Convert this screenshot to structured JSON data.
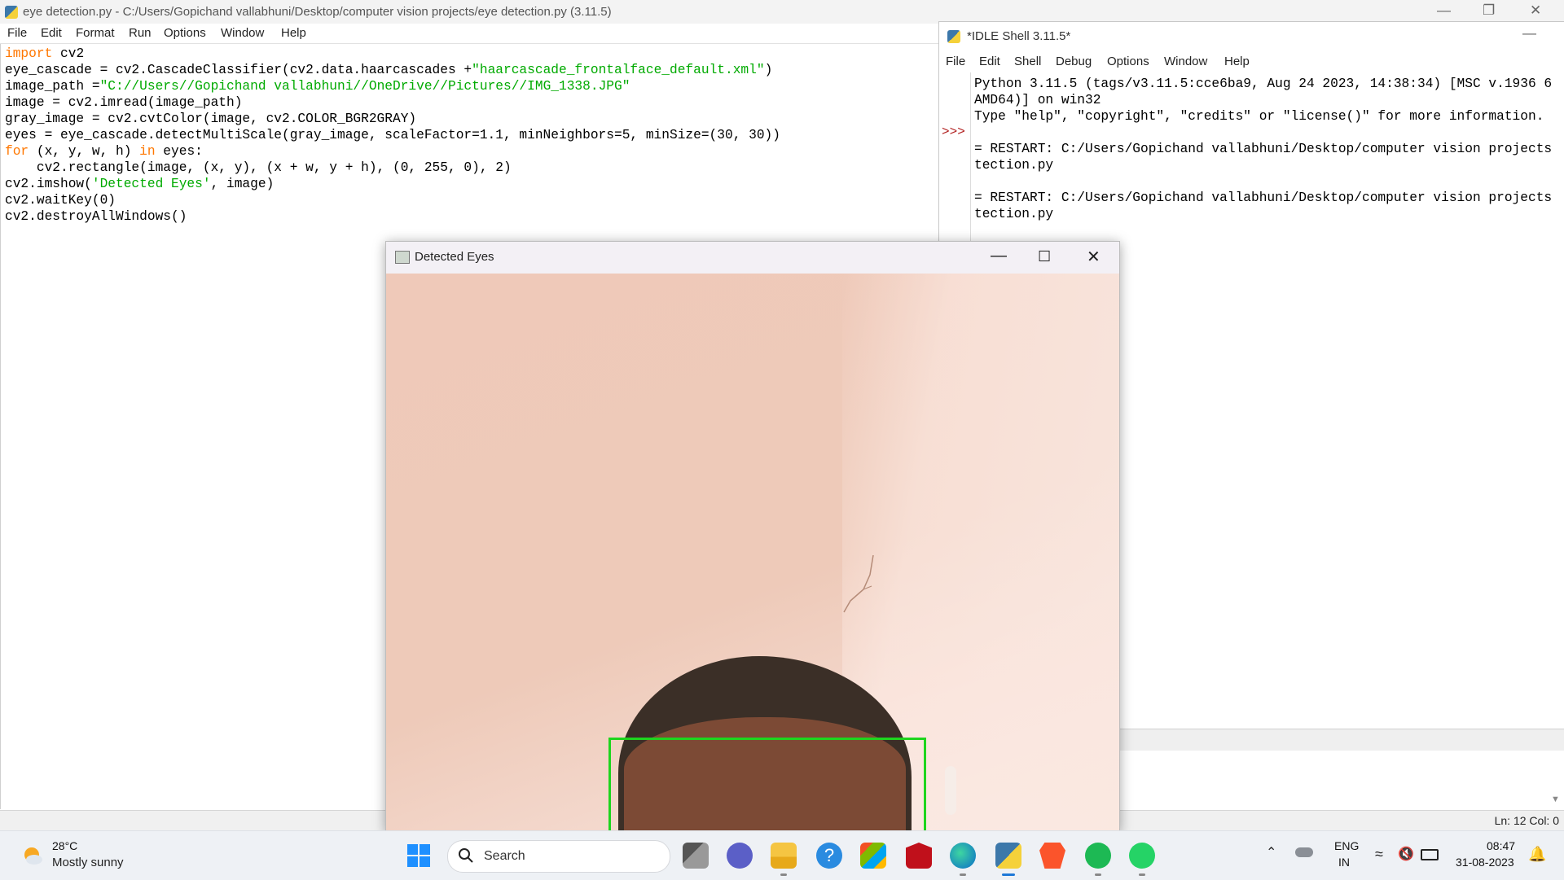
{
  "editor": {
    "title": "eye detection.py - C:/Users/Gopichand vallabhuni/Desktop/computer vision projects/eye detection.py (3.11.5)",
    "menu": [
      "File",
      "Edit",
      "Format",
      "Run",
      "Options",
      "Window",
      "Help"
    ],
    "code_lines": [
      [
        {
          "t": "import",
          "c": "kw"
        },
        {
          "t": " cv2"
        }
      ],
      [
        {
          "t": "eye_cascade = cv2.CascadeClassifier(cv2.data.haarcascades +"
        },
        {
          "t": "\"haarcascade_frontalface_default.xml\"",
          "c": "str"
        },
        {
          "t": ")"
        }
      ],
      [
        {
          "t": "image_path ="
        },
        {
          "t": "\"C://Users//Gopichand vallabhuni//OneDrive//Pictures//IMG_1338.JPG\"",
          "c": "str"
        }
      ],
      [
        {
          "t": "image = cv2.imread(image_path)"
        }
      ],
      [
        {
          "t": "gray_image = cv2.cvtColor(image, cv2.COLOR_BGR2GRAY)"
        }
      ],
      [
        {
          "t": "eyes = eye_cascade.detectMultiScale(gray_image, scaleFactor=1.1, minNeighbors=5, minSize=(30, 30))"
        }
      ],
      [
        {
          "t": "for",
          "c": "kw"
        },
        {
          "t": " (x, y, w, h) "
        },
        {
          "t": "in",
          "c": "kw"
        },
        {
          "t": " eyes:"
        }
      ],
      [
        {
          "t": "    cv2.rectangle(image, (x, y), (x + w, y + h), (0, 255, 0), 2)"
        }
      ],
      [
        {
          "t": "cv2.imshow("
        },
        {
          "t": "'Detected Eyes'",
          "c": "str"
        },
        {
          "t": ", image)"
        }
      ],
      [
        {
          "t": "cv2.waitKey(0)"
        }
      ],
      [
        {
          "t": "cv2.destroyAllWindows()"
        }
      ]
    ],
    "status": "Ln: 12   Col: 0"
  },
  "shell": {
    "title": "*IDLE Shell 3.11.5*",
    "menu": [
      "File",
      "Edit",
      "Shell",
      "Debug",
      "Options",
      "Window",
      "Help"
    ],
    "prompt": ">>>",
    "output": "Python 3.11.5 (tags/v3.11.5:cce6ba9, Aug 24 2023, 14:38:34) [MSC v.1936 6\nAMD64)] on win32\nType \"help\", \"copyright\", \"credits\" or \"license()\" for more information.\n\n= RESTART: C:/Users/Gopichand vallabhuni/Desktop/computer vision projects\ntection.py\n\n= RESTART: C:/Users/Gopichand vallabhuni/Desktop/computer vision projects\ntection.py"
  },
  "cv_window": {
    "title": "Detected Eyes"
  },
  "taskbar": {
    "weather_temp": "28°C",
    "weather_desc": "Mostly sunny",
    "search_label": "Search",
    "lang": "ENG",
    "region": "IN",
    "time": "08:47",
    "date": "31-08-2023",
    "apps": [
      "task-view",
      "teams",
      "file-explorer",
      "help",
      "microsoft-store",
      "mcafee",
      "edge",
      "python-idle",
      "brave",
      "spotify",
      "whatsapp"
    ]
  },
  "colors": {
    "keyword": "#ff7700",
    "string": "#00aa00",
    "prompt": "#b22222",
    "detection_box": "#1ed51e"
  }
}
